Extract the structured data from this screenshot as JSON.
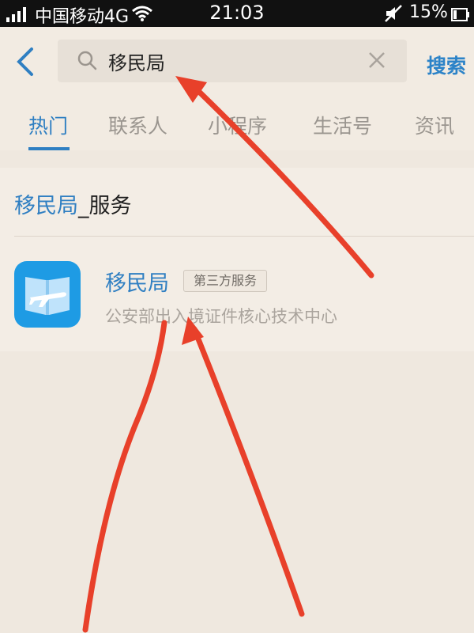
{
  "status_bar": {
    "carrier": "中国移动4G",
    "time": "21:03",
    "battery": "15%"
  },
  "search": {
    "query": "移民局",
    "button_label": "搜索"
  },
  "tabs": [
    {
      "label": "热门",
      "active": true
    },
    {
      "label": "联系人",
      "active": false
    },
    {
      "label": "小程序",
      "active": false
    },
    {
      "label": "生活号",
      "active": false
    },
    {
      "label": "资讯",
      "active": false
    }
  ],
  "section": {
    "title_highlight": "移民局",
    "title_rest": "_服务"
  },
  "result": {
    "name": "移民局",
    "badge": "第三方服务",
    "description": "公安部出入境证件核心技术中心",
    "icon": "plane-book-icon"
  },
  "colors": {
    "accent": "#2f7fc2",
    "annotation_arrow": "#e8402a",
    "app_icon": "#1e9be4"
  }
}
